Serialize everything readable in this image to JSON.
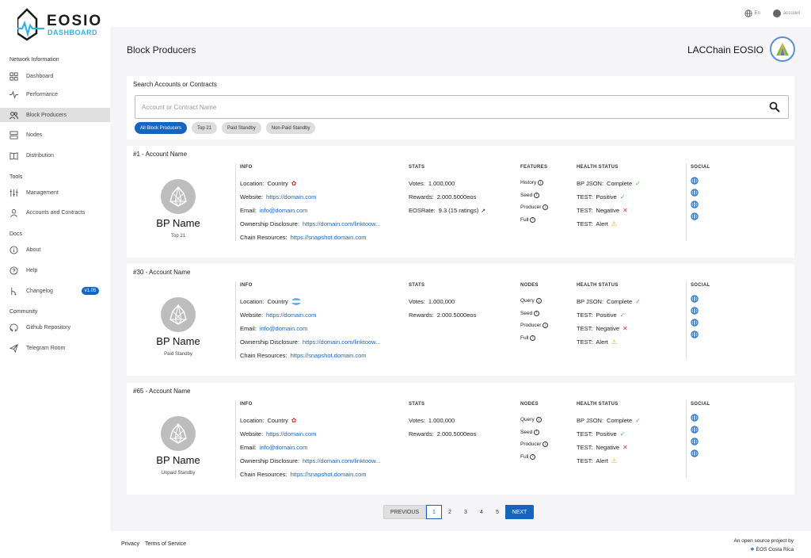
{
  "logo": {
    "line1": "EOSIO",
    "line2": "DASHBOARD"
  },
  "sidebar": {
    "sections": [
      {
        "title": "Network Information",
        "items": [
          {
            "label": "Dashboard",
            "icon": "grid-icon"
          },
          {
            "label": "Performance",
            "icon": "pulse-icon"
          },
          {
            "label": "Block Producers",
            "icon": "users-icon",
            "active": true
          },
          {
            "label": "Nodes",
            "icon": "server-icon"
          },
          {
            "label": "Distribution",
            "icon": "book-icon"
          }
        ]
      },
      {
        "title": "Tools",
        "items": [
          {
            "label": "Management",
            "icon": "sliders-icon"
          },
          {
            "label": "Accounts and Contracts",
            "icon": "user-icon"
          }
        ]
      },
      {
        "title": "Docs",
        "items": [
          {
            "label": "About",
            "icon": "info-icon"
          },
          {
            "label": "Help",
            "icon": "help-icon"
          },
          {
            "label": "Changelog",
            "icon": "git-icon",
            "badge": "v1.05"
          }
        ]
      },
      {
        "title": "Community",
        "items": [
          {
            "label": "Github Repository",
            "icon": "github-icon"
          },
          {
            "label": "Telegram Room",
            "icon": "send-icon"
          }
        ]
      }
    ]
  },
  "topbar": {
    "lang": "En",
    "account": "account"
  },
  "header": {
    "title": "Block Producers",
    "chain": "LACChain EOSIO"
  },
  "search": {
    "title": "Search Accounts or Contracts",
    "placeholder": "Account or Contract Name",
    "chips": [
      "All Block Producers",
      "Top 21",
      "Paid Standby",
      "Non-Paid Standby"
    ]
  },
  "labels": {
    "info": "INFO",
    "stats": "STATS",
    "health": "HEALTH STATUS",
    "social": "SOCIAL",
    "location": "Location:",
    "website": "Website:",
    "email": "Email:",
    "ownership": "Ownership Disclosure:",
    "chain_resources": "Chain Resources:",
    "votes": "Votes:",
    "rewards": "Rewards:",
    "eosrate": "EOSRate:",
    "bpjson": "BP JSON:",
    "test": "TEST:"
  },
  "producers": [
    {
      "rank": "#1 - Account Name",
      "name": "BP Name",
      "type": "Top 21",
      "country": "Country",
      "flag": "ca",
      "website": "https://domain.com",
      "email": "info@domain.com",
      "ownership": "https://domain.com/linktoow...",
      "chain_resources": "https://snapshot.domain.com",
      "votes": "1.000,000",
      "rewards": "2.000.5000eos",
      "eosrate": "9.3 (15 ratings)",
      "features_title": "FEATURES",
      "features": [
        "History",
        "Seed",
        "Producer",
        "Full"
      ],
      "health": [
        {
          "label": "BP JSON:",
          "value": "Complete",
          "status": "ok"
        },
        {
          "label": "TEST:",
          "value": "Positive",
          "status": "ok"
        },
        {
          "label": "TEST:",
          "value": "Negative",
          "status": "bad"
        },
        {
          "label": "TEST:",
          "value": "Alert",
          "status": "warn"
        }
      ]
    },
    {
      "rank": "#30 - Account Name",
      "name": "BP Name",
      "type": "Paid Standby",
      "country": "Country",
      "flag": "ar",
      "website": "https://domain.com",
      "email": "info@domain.com",
      "ownership": "https://domain.com/linktoow...",
      "chain_resources": "https://snapshot.domain.com",
      "votes": "1.000,000",
      "rewards": "2.000.5000eos",
      "eosrate": "",
      "features_title": "NODES",
      "features": [
        "Query",
        "Seed",
        "Producer",
        "Full"
      ],
      "health": [
        {
          "label": "BP JSON:",
          "value": "Complete",
          "status": "ok"
        },
        {
          "label": "TEST:",
          "value": "Positive",
          "status": "ok"
        },
        {
          "label": "TEST:",
          "value": "Negative",
          "status": "bad"
        },
        {
          "label": "TEST:",
          "value": "Alert",
          "status": "warn"
        }
      ]
    },
    {
      "rank": "#65 - Account Name",
      "name": "BP Name",
      "type": "Unpaid Standby",
      "country": "Country",
      "flag": "ca",
      "website": "https://domain.com",
      "email": "info@domain.com",
      "ownership": "https://domain.com/linktoow...",
      "chain_resources": "https://snapshot.domain.com",
      "votes": "1.000,000",
      "rewards": "2.000.5000eos",
      "eosrate": "",
      "features_title": "NODES",
      "features": [
        "Query",
        "Seed",
        "Producer",
        "Full"
      ],
      "health": [
        {
          "label": "BP JSON:",
          "value": "Complete",
          "status": "ok"
        },
        {
          "label": "TEST:",
          "value": "Positive",
          "status": "ok"
        },
        {
          "label": "TEST:",
          "value": "Negative",
          "status": "bad"
        },
        {
          "label": "TEST:",
          "value": "Alert",
          "status": "warn"
        }
      ]
    }
  ],
  "pagination": {
    "prev": "PREVIOUS",
    "pages": [
      "1",
      "2",
      "3",
      "4",
      "5"
    ],
    "current": "1",
    "next": "NEXT"
  },
  "footer": {
    "privacy": "Privacy",
    "terms": "Terms of Service",
    "tagline": "An open source project by",
    "org": "EOS Costa Rica"
  },
  "colors": {
    "accent": "#1565c0",
    "logo_accent": "#2fb3e8",
    "ok": "#4caf50",
    "bad": "#e53935",
    "warn": "#f4a300"
  }
}
